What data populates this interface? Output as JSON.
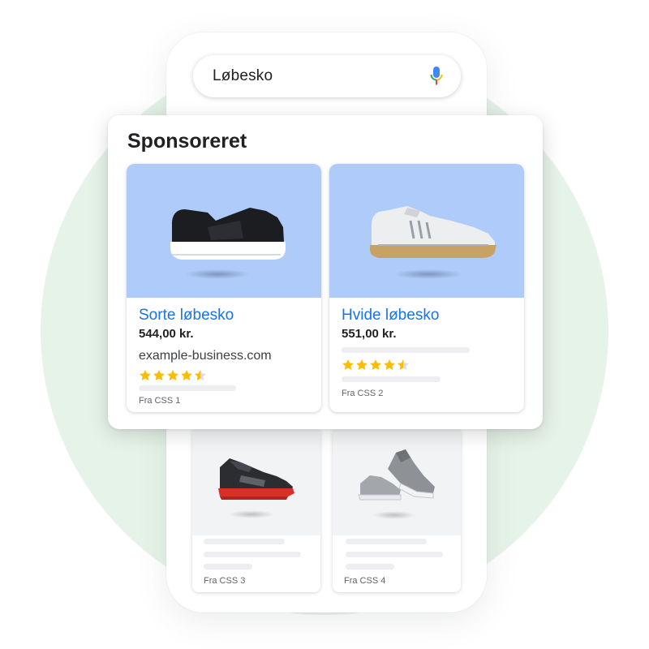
{
  "search": {
    "query": "Løbesko"
  },
  "sponsored": {
    "heading": "Sponsoreret",
    "products": [
      {
        "name": "Sorte løbesko",
        "price": "544,00 kr.",
        "domain": "example-business.com",
        "rating": 4.5,
        "source": "Fra CSS 1",
        "image": "black-running-shoe"
      },
      {
        "name": "Hvide løbesko",
        "price": "551,00 kr.",
        "rating": 4.5,
        "source": "Fra CSS 2",
        "image": "white-running-shoe"
      }
    ]
  },
  "results": [
    {
      "source": "Fra CSS 3",
      "image": "black-red-running-shoe"
    },
    {
      "source": "Fra CSS 4",
      "image": "grey-running-shoes-pair"
    }
  ],
  "colors": {
    "product_bg": "#aecbfa",
    "link": "#1a73e8",
    "star": "#fbbc04",
    "circle": "#e6f3e8"
  }
}
